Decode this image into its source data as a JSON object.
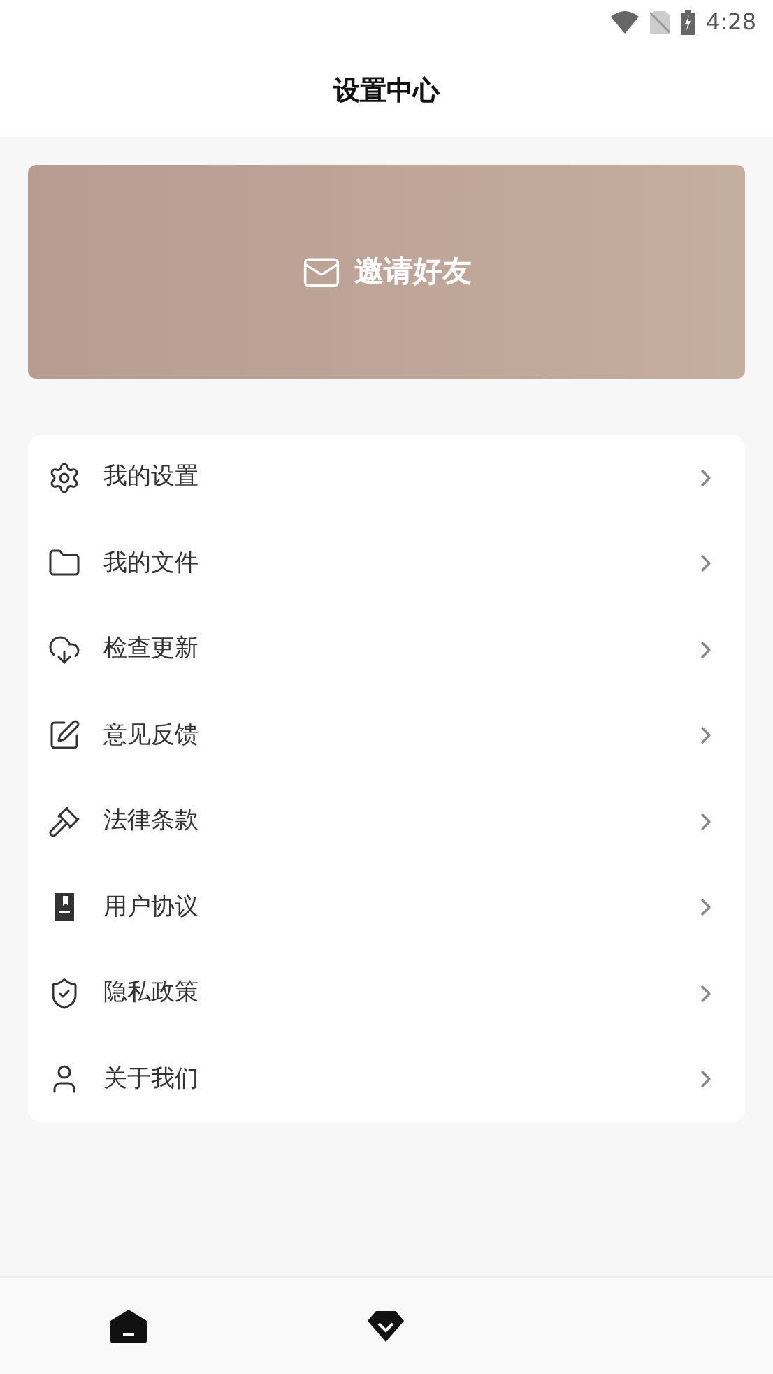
{
  "status_bar": {
    "time": "4:28"
  },
  "header": {
    "title": "设置中心"
  },
  "banner": {
    "label": "邀请好友"
  },
  "menu": [
    {
      "label": "我的设置"
    },
    {
      "label": "我的文件"
    },
    {
      "label": "检查更新"
    },
    {
      "label": "意见反馈"
    },
    {
      "label": "法律条款"
    },
    {
      "label": "用户协议"
    },
    {
      "label": "隐私政策"
    },
    {
      "label": "关于我们"
    }
  ]
}
